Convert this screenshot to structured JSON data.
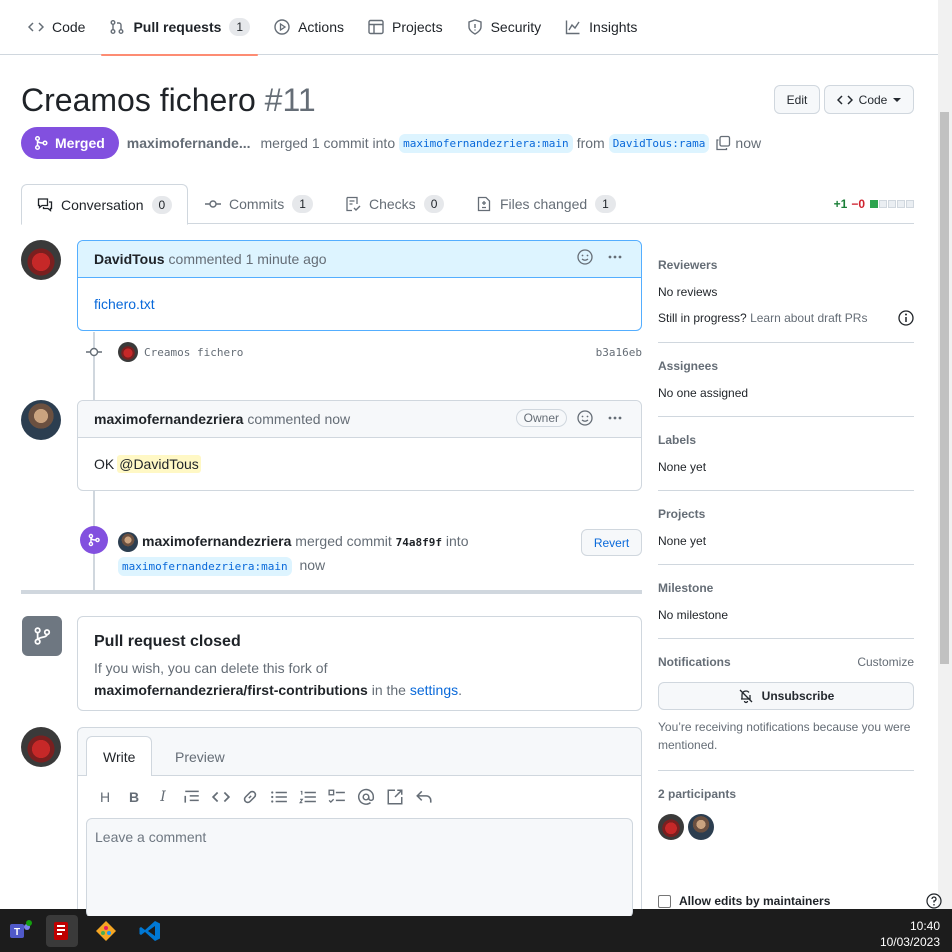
{
  "nav": {
    "code": "Code",
    "pull_requests": "Pull requests",
    "pull_requests_count": "1",
    "actions": "Actions",
    "projects": "Projects",
    "security": "Security",
    "insights": "Insights"
  },
  "pr": {
    "title": "Creamos fichero",
    "number": "#11",
    "edit_label": "Edit",
    "code_label": "Code",
    "status": "Merged",
    "author": "maximofernande...",
    "merged_text": "merged 1 commit into",
    "base_branch": "maximofernandezriera:main",
    "from_text": "from",
    "head_branch": "DavidTous:rama",
    "time": "now"
  },
  "tabs": [
    {
      "label": "Conversation",
      "count": "0"
    },
    {
      "label": "Commits",
      "count": "1"
    },
    {
      "label": "Checks",
      "count": "0"
    },
    {
      "label": "Files changed",
      "count": "1"
    }
  ],
  "diffstat": {
    "additions": "+1",
    "deletions": "−0"
  },
  "timeline": {
    "comment1": {
      "author": "DavidTous",
      "meta": "commented 1 minute ago",
      "body": "fichero.txt"
    },
    "commit": {
      "message": "Creamos fichero",
      "sha": "b3a16eb"
    },
    "comment2": {
      "author": "maximofernandezriera",
      "meta": "commented now",
      "badge": "Owner",
      "body": "OK",
      "mention": "@DavidTous"
    },
    "merge": {
      "author": "maximofernandezriera",
      "text": "merged commit",
      "sha": "74a8f9f",
      "into": "into",
      "branch": "maximofernandezriera:main",
      "time": "now",
      "revert_label": "Revert"
    },
    "closed": {
      "title": "Pull request closed",
      "line1": "If you wish, you can delete this fork of",
      "repo": "maximofernandezriera/first-contributions",
      "in_the": "in the",
      "settings": "settings",
      "period": "."
    }
  },
  "editor": {
    "write_tab": "Write",
    "preview_tab": "Preview",
    "placeholder": "Leave a comment",
    "toolbar": [
      "H",
      "B",
      "I"
    ]
  },
  "sidebar": {
    "reviewers": {
      "title": "Reviewers",
      "value": "No reviews",
      "draft_prefix": "Still in progress?",
      "draft_link": "Learn about draft PRs"
    },
    "assignees": {
      "title": "Assignees",
      "value": "No one assigned"
    },
    "labels": {
      "title": "Labels",
      "value": "None yet"
    },
    "projects": {
      "title": "Projects",
      "value": "None yet"
    },
    "milestone": {
      "title": "Milestone",
      "value": "No milestone"
    },
    "notifications": {
      "title": "Notifications",
      "customize": "Customize",
      "button": "Unsubscribe",
      "note": "You’re receiving notifications because you were mentioned."
    },
    "participants": {
      "title": "2 participants"
    },
    "allow_edits": "Allow edits by maintainers"
  },
  "taskbar": {
    "time": "10:40",
    "date": "10/03/2023"
  },
  "colors": {
    "merged": "#8250df",
    "link": "#0969da",
    "tab_underline": "#fd8c73"
  }
}
